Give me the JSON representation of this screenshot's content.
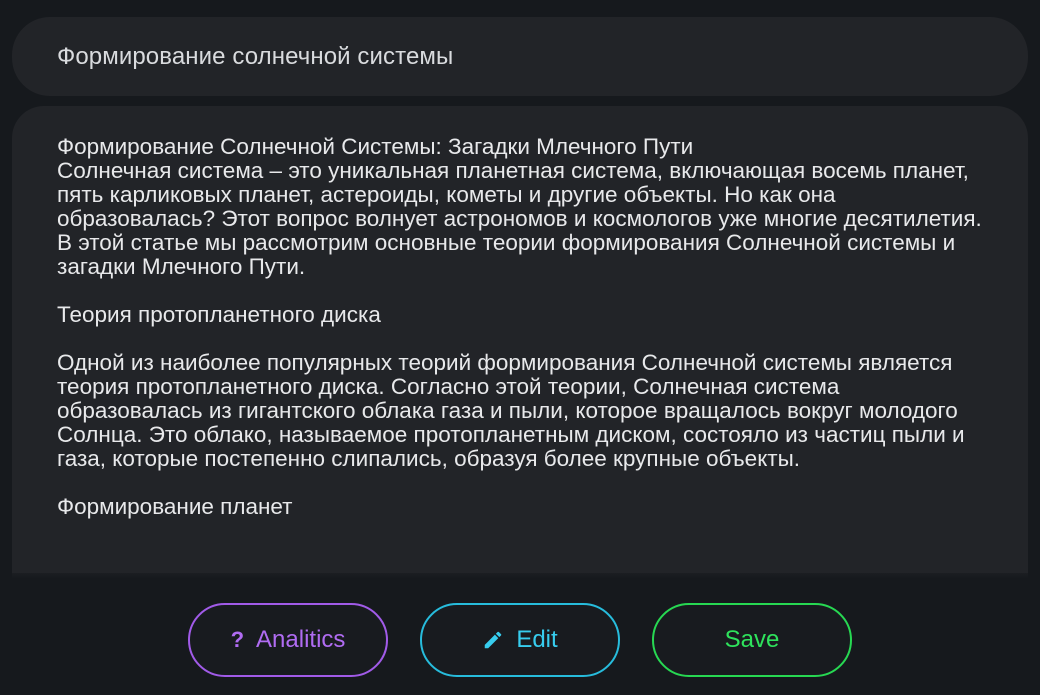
{
  "title": {
    "text": "Формирование солнечной системы"
  },
  "article": {
    "heading_line": "Формирование Солнечной Системы: Загадки Млечного Пути",
    "intro": "Солнечная система – это уникальная планетная система, включающая восемь планет, пять карликовых планет, астероиды, кометы и другие объекты. Но как она образовалась? Этот вопрос волнует астрономов и космологов уже многие десятилетия. В этой статье мы рассмотрим основные теории формирования Солнечной системы и загадки Млечного Пути.",
    "section1_title": "Теория протопланетного диска",
    "section1_text": "Одной из наиболее популярных теорий формирования Солнечной системы является теория протопланетного диска. Согласно этой теории, Солнечная система образовалась из гигантского облака газа и пыли, которое вращалось вокруг молодого Солнца. Это облако, называемое протопланетным диском, состояло из частиц пыли и газа, которые постепенно слипались, образуя более крупные объекты.",
    "section2_title": "Формирование планет"
  },
  "actions": {
    "analytics_label": "Analitics",
    "analytics_icon": "question-mark-icon",
    "edit_label": "Edit",
    "edit_icon": "pencil-icon",
    "save_label": "Save"
  },
  "colors": {
    "background": "#16191d",
    "card": "#222428",
    "analytics_accent": "#b06cf2",
    "edit_accent": "#37cdee",
    "save_accent": "#2ee35c"
  }
}
